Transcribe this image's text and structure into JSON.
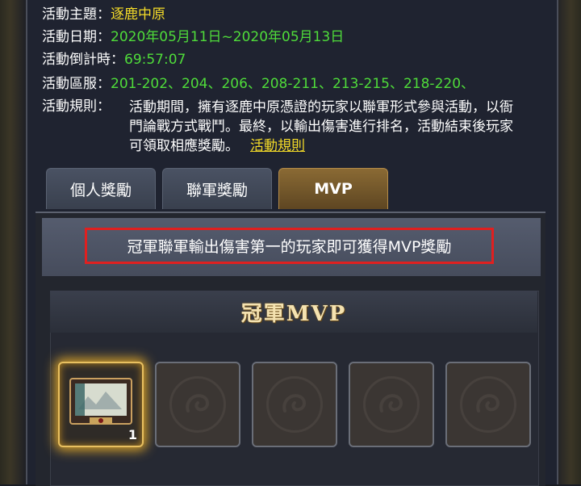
{
  "event_info": {
    "theme_label": "活動主題：",
    "theme_value": "逐鹿中原",
    "date_label": "活動日期：",
    "date_value": "2020年05月11日~2020年05月13日",
    "countdown_label": "活動倒計時：",
    "countdown_value": "69:57:07",
    "servers_label": "活動區服：",
    "servers_value": "201-202、204、206、208-211、213-215、218-220、",
    "rules_label": "活動規則：",
    "rules_text": "活動期間，擁有逐鹿中原憑證的玩家以聯軍形式參與活動，以衙門論戰方式戰鬥。最終，以輸出傷害進行排名，活動結束後玩家可領取相應獎勵。",
    "rules_link": "活動規則"
  },
  "tabs": [
    {
      "label": "個人獎勵",
      "active": false
    },
    {
      "label": "聯軍獎勵",
      "active": false
    },
    {
      "label": "MVP",
      "active": true
    }
  ],
  "notice": "冠軍聯軍輸出傷害第一的玩家即可獲得MVP獎勵",
  "reward_section": {
    "title": "冠軍MVP",
    "slots": [
      {
        "icon": "scroll-item-icon",
        "count": "1",
        "filled": true
      },
      {
        "icon": "empty-slot-emblem-icon",
        "filled": false
      },
      {
        "icon": "empty-slot-emblem-icon",
        "filled": false
      },
      {
        "icon": "empty-slot-emblem-icon",
        "filled": false
      },
      {
        "icon": "empty-slot-emblem-icon",
        "filled": false
      }
    ]
  },
  "colors": {
    "highlight_yellow": "#f5dc28",
    "value_green": "#4fdc3a",
    "notice_border": "#e02020",
    "active_tab": "#8a6a34"
  }
}
